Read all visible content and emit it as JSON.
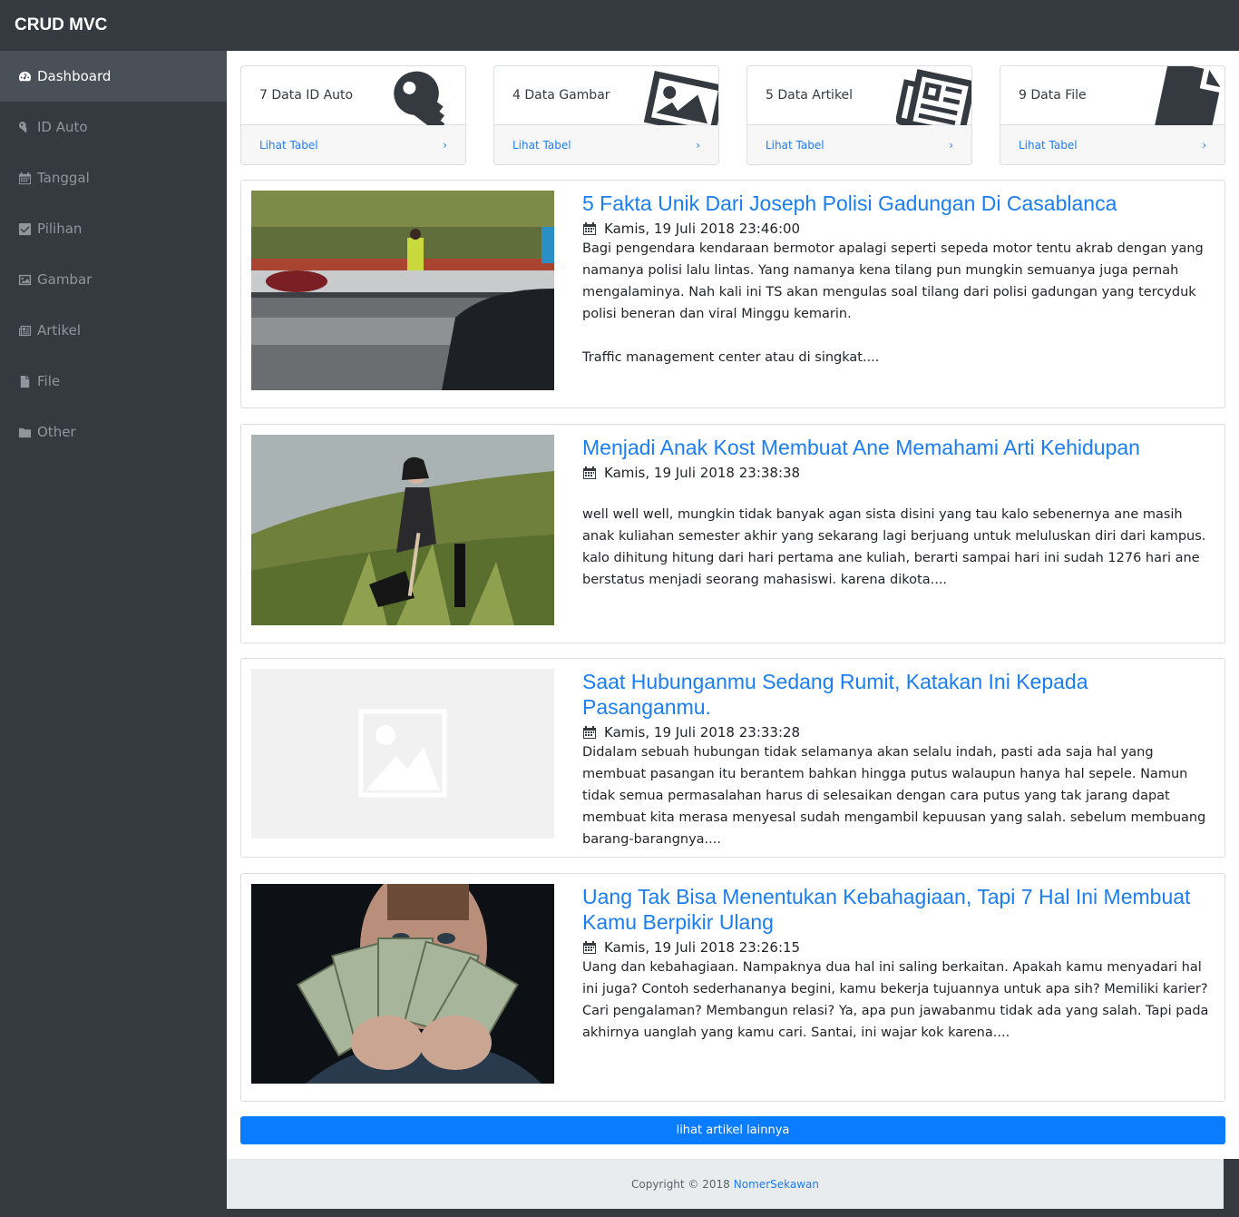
{
  "app": {
    "brand": "CRUD MVC"
  },
  "sidebar": {
    "items": [
      {
        "label": "Dashboard",
        "icon": "dashboard-icon",
        "active": true
      },
      {
        "label": "ID Auto",
        "icon": "key-icon"
      },
      {
        "label": "Tanggal",
        "icon": "calendar-icon"
      },
      {
        "label": "Pilihan",
        "icon": "checkbox-icon"
      },
      {
        "label": "Gambar",
        "icon": "image-icon"
      },
      {
        "label": "Artikel",
        "icon": "newspaper-icon"
      },
      {
        "label": "File",
        "icon": "file-icon"
      },
      {
        "label": "Other",
        "icon": "folder-icon"
      }
    ]
  },
  "cards": [
    {
      "title": "7 Data ID Auto",
      "link": "Lihat Tabel",
      "icon": "key-icon"
    },
    {
      "title": "4 Data Gambar",
      "link": "Lihat Tabel",
      "icon": "image-icon"
    },
    {
      "title": "5 Data Artikel",
      "link": "Lihat Tabel",
      "icon": "newspaper-icon"
    },
    {
      "title": "9 Data File",
      "link": "Lihat Tabel",
      "icon": "file-icon"
    }
  ],
  "articles": [
    {
      "title": "5 Fakta Unik Dari Joseph Polisi Gadungan Di Casablanca",
      "date": "Kamis, 19 Juli 2018 23:46:00",
      "excerpt": "Bagi pengendara kendaraan bermotor apalagi seperti sepeda motor tentu akrab dengan yang namanya polisi lalu lintas. Yang namanya kena tilang pun mungkin semuanya juga pernah mengalaminya. Nah kali ini TS akan mengulas soal tilang dari polisi gadungan yang tercyduk polisi beneran dan viral Minggu kemarin.\n\nTraffic management center atau di singkat...."
    },
    {
      "title": "Menjadi Anak Kost Membuat Ane Memahami Arti Kehidupan",
      "date": "Kamis, 19 Juli 2018 23:38:38",
      "excerpt": "\nwell well well, mungkin tidak banyak agan sista disini yang tau kalo sebenernya ane masih anak kuliahan semester akhir yang sekarang lagi berjuang untuk meluluskan diri dari kampus. kalo dihitung hitung dari hari pertama ane kuliah, berarti sampai hari ini sudah 1276 hari ane berstatus menjadi seorang mahasiswi. karena dikota...."
    },
    {
      "title": "Saat Hubunganmu Sedang Rumit, Katakan Ini Kepada Pasanganmu.",
      "date": "Kamis, 19 Juli 2018 23:33:28",
      "excerpt": "Didalam sebuah hubungan tidak selamanya akan selalu indah, pasti ada saja hal yang membuat pasangan itu berantem bahkan hingga putus walaupun hanya hal sepele. Namun tidak semua permasalahan harus di selesaikan dengan cara putus yang tak jarang dapat membuat kita merasa menyesal sudah mengambil kepuusan yang salah. sebelum membuang barang-barangnya...."
    },
    {
      "title": "Uang Tak Bisa Menentukan Kebahagiaan, Tapi 7 Hal Ini Membuat Kamu Berpikir Ulang",
      "date": "Kamis, 19 Juli 2018 23:26:15",
      "excerpt": "Uang dan kebahagiaan. Nampaknya dua hal ini saling berkaitan. Apakah kamu menyadari hal ini juga? Contoh sederhananya begini, kamu bekerja tujuannya untuk apa sih? Memiliki karier? Cari pengalaman? Membangun relasi? Ya, apa pun jawabanmu tidak ada yang salah. Tapi pada akhirnya uanglah yang kamu cari. Santai, ini wajar kok karena...."
    }
  ],
  "more_button": "lihat artikel lainnya",
  "footer": {
    "text": "Copyright © 2018",
    "link": "NomerSekawan"
  }
}
